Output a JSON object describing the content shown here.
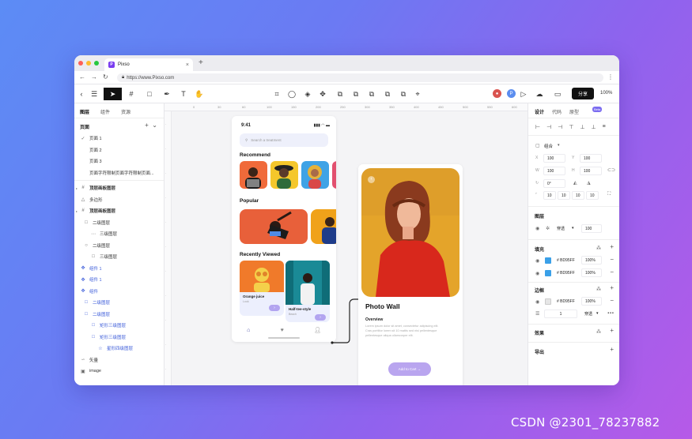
{
  "browser": {
    "tab_title": "Pixso",
    "url": "https://www.Pixso.com",
    "favicon_letter": "P"
  },
  "toolbar": {
    "share_label": "分享",
    "zoom": "100%",
    "avatar_letter": "P"
  },
  "left_panel": {
    "tabs": [
      "图层",
      "组件",
      "资源"
    ],
    "pages_header": "页面",
    "pages": [
      "页面 1",
      "页面 2",
      "页面 3",
      "页面字符限制页面字符限制页面..."
    ],
    "layers": [
      {
        "label": "顶层画板图层",
        "icon": "#",
        "indent": 0,
        "blue": false,
        "bold": true
      },
      {
        "label": "多边形",
        "icon": "△",
        "indent": 0,
        "blue": false,
        "bold": false
      },
      {
        "label": "顶层画板图层",
        "icon": "#",
        "indent": 0,
        "blue": false,
        "bold": true
      },
      {
        "label": "二级图层",
        "icon": "□",
        "indent": 1,
        "blue": false,
        "bold": false
      },
      {
        "label": "三级图层",
        "icon": "⋯",
        "indent": 2,
        "blue": false,
        "bold": false
      },
      {
        "label": "二级图层",
        "icon": "○",
        "indent": 1,
        "blue": false,
        "bold": false
      },
      {
        "label": "三级图层",
        "icon": "□",
        "indent": 2,
        "blue": false,
        "bold": false
      },
      {
        "label": "组件 1",
        "icon": "✥",
        "indent": 0,
        "blue": true,
        "bold": false
      },
      {
        "label": "组件 1",
        "icon": "✥",
        "indent": 0,
        "blue": true,
        "bold": false
      },
      {
        "label": "组件",
        "icon": "✥",
        "indent": 0,
        "blue": true,
        "bold": false
      },
      {
        "label": "二级图层",
        "icon": "□",
        "indent": 1,
        "blue": true,
        "bold": false
      },
      {
        "label": "二级图层",
        "icon": "□",
        "indent": 1,
        "blue": true,
        "bold": false
      },
      {
        "label": "矩形三级图层",
        "icon": "□",
        "indent": 2,
        "blue": true,
        "bold": false
      },
      {
        "label": "矩形三级图层",
        "icon": "□",
        "indent": 2,
        "blue": true,
        "bold": false
      },
      {
        "label": "星形四级图层",
        "icon": "☆",
        "indent": 3,
        "blue": true,
        "bold": false
      },
      {
        "label": "矢量",
        "icon": "∽",
        "indent": 0,
        "blue": false,
        "bold": false
      },
      {
        "label": "image",
        "icon": "▣",
        "indent": 0,
        "blue": false,
        "bold": false
      }
    ]
  },
  "ruler": [
    "0",
    "30",
    "60",
    "100",
    "150",
    "200",
    "250",
    "300",
    "350",
    "400",
    "450",
    "500",
    "550",
    "600"
  ],
  "phone": {
    "time": "9:41",
    "search_placeholder": "Search a treatment",
    "recommend": "Recommend",
    "popular": "Popular",
    "recently_viewed": "Recently Viewed",
    "cards": [
      {
        "title": "Orange juice",
        "sub": "Look"
      },
      {
        "title": "Half-tee-style",
        "sub": "Beach"
      }
    ]
  },
  "photo_wall": {
    "title": "Photo Wall",
    "overview_label": "Overview",
    "overview_text": "Lorem ipsum dolor sit amet, consectetur adipiscing elit. Cras porttitor lorem sit 10 mattis sed nisi pellentesque pellentesque aliqua ullamcorper elit.",
    "button": "Add to Cart →"
  },
  "right_panel": {
    "tabs": [
      "设计",
      "代码",
      "原型"
    ],
    "beta": "Beta",
    "group_label": "组合",
    "x": "100",
    "y": "100",
    "w": "100",
    "h": "100",
    "rotation": "0°",
    "radii": [
      "10",
      "10",
      "10",
      "10"
    ],
    "layer_section": "图层",
    "pass_through": "穿透",
    "opacity": "100",
    "fill_section": "填充",
    "fills": [
      {
        "hex": "BD95FF",
        "pct": "100%",
        "color": "#3aa0e8"
      },
      {
        "hex": "BD95FF",
        "pct": "100%",
        "color": "#3aa0e8"
      }
    ],
    "stroke_section": "边框",
    "stroke": {
      "hex": "BD95FF",
      "pct": "100%",
      "width": "1",
      "position": "穿透"
    },
    "effect_section": "效果",
    "export_section": "导出"
  },
  "watermark": "CSDN @2301_78237882"
}
